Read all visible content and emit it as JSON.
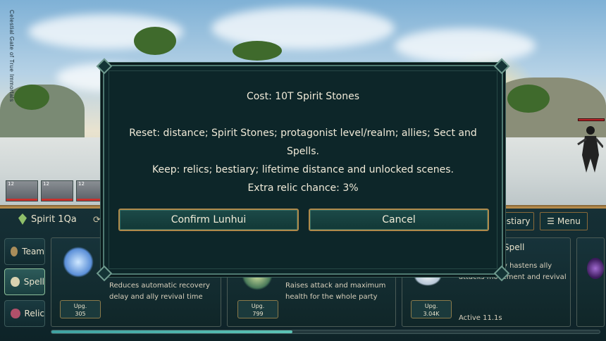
{
  "scene": {
    "vertical_title": "Celestial Gate of True Immortals"
  },
  "allies": [
    {
      "level": "12"
    },
    {
      "level": "12"
    },
    {
      "level": "12"
    }
  ],
  "header": {
    "spirit_label": "Spirit 1Qa",
    "bestiary_label": "estiary",
    "menu_label": "Menu"
  },
  "tabs": [
    {
      "label": "Team"
    },
    {
      "label": "Spell"
    },
    {
      "label": "Relic"
    }
  ],
  "cards": [
    {
      "desc_line1": "Reduces automatic recovery",
      "desc_line2": "delay and ally revival time",
      "upg_label": "Upg.",
      "upg_value": "305"
    },
    {
      "desc_line1": "Raises attack and maximum",
      "desc_line2": "health for the whole party",
      "upg_label": "Upg.",
      "upg_value": "799"
    },
    {
      "title": "Spell",
      "desc_line1": "Automatically hastens ally",
      "desc_line2": "attacks movement and revival",
      "upg_label": "Upg.",
      "upg_value": "3.04K",
      "active": "Active  11.1s"
    }
  ],
  "progress": {
    "fraction": 0.44
  },
  "modal": {
    "cost": "Cost: 10T Spirit Stones",
    "reset_line1": "Reset: distance; Spirit Stones; protagonist level/realm; allies; Sect and",
    "reset_line2": "Spells.",
    "keep": "Keep: relics; bestiary; lifetime distance and unlocked scenes.",
    "extra": "Extra relic chance: 3%",
    "confirm_label": "Confirm Lunhui",
    "cancel_label": "Cancel"
  },
  "colors": {
    "panel": "#0e2328",
    "accent_gold": "#b08a4a",
    "modal_bg": "#0d2629"
  }
}
